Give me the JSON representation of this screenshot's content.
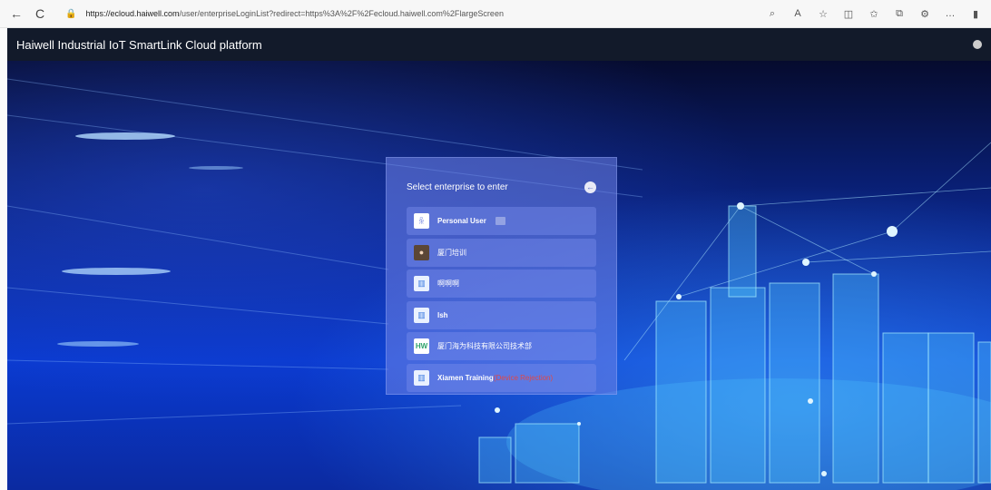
{
  "browser": {
    "back_icon": "←",
    "refresh_icon": "C",
    "url_host": "https://ecloud.haiwell.com",
    "url_path": "/user/enterpriseLoginList?redirect=https%3A%2F%2Fecloud.haiwell.com%2FlargeScreen",
    "icons": [
      "search-icon",
      "read-aloud-icon",
      "favorite-icon",
      "split-screen-icon",
      "favorites-icon",
      "collections-icon",
      "extensions-icon",
      "more-icon",
      "sidebar-icon"
    ]
  },
  "app": {
    "title": "Haiwell Industrial IoT SmartLink Cloud platform"
  },
  "panel": {
    "title": "Select enterprise to enter",
    "items": [
      {
        "label": "Personal User",
        "avatar": "user-icon"
      },
      {
        "label": "厦门培训",
        "avatar": "photo"
      },
      {
        "label": "啊啊啊",
        "avatar": "building-icon"
      },
      {
        "label": "lsh",
        "avatar": "building-icon"
      },
      {
        "label": "厦门海为科技有限公司技术部",
        "avatar": "logo"
      },
      {
        "label": "Xiamen Training",
        "suffix": "(Device Rejection)",
        "avatar": "building-icon"
      }
    ]
  }
}
